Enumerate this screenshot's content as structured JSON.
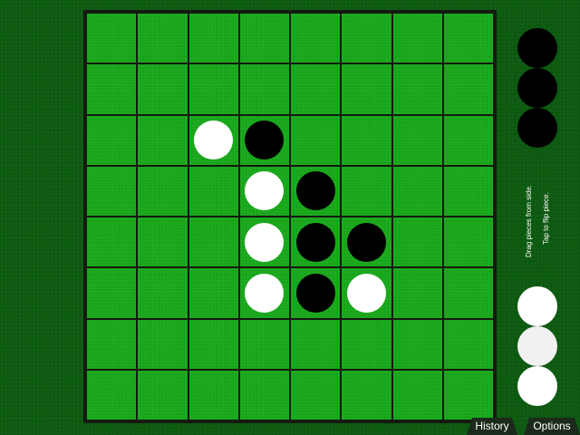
{
  "board": {
    "size": 8,
    "rows": [
      [
        "",
        "",
        "",
        "",
        "",
        "",
        "",
        ""
      ],
      [
        "",
        "",
        "",
        "",
        "",
        "",
        "",
        ""
      ],
      [
        "",
        "",
        "W",
        "B",
        "",
        "",
        "",
        ""
      ],
      [
        "",
        "",
        "",
        "W",
        "B",
        "",
        "",
        ""
      ],
      [
        "",
        "",
        "",
        "W",
        "B",
        "B",
        "",
        ""
      ],
      [
        "",
        "",
        "",
        "W",
        "B",
        "W",
        "",
        ""
      ],
      [
        "",
        "",
        "",
        "",
        "",
        "",
        "",
        ""
      ],
      [
        "",
        "",
        "",
        "",
        "",
        "",
        "",
        ""
      ]
    ]
  },
  "supply": {
    "black_count": 3,
    "white_count": 3
  },
  "instructions": {
    "drag": "Drag pieces from side.",
    "tap": "Tap to flip piece."
  },
  "buttons": {
    "history": "History",
    "options": "Options"
  },
  "colors": {
    "felt": "#0c5a10",
    "cell": "#17a81a",
    "grid_line": "#151a10",
    "black_piece": "#000000",
    "white_piece": "#ffffff"
  }
}
